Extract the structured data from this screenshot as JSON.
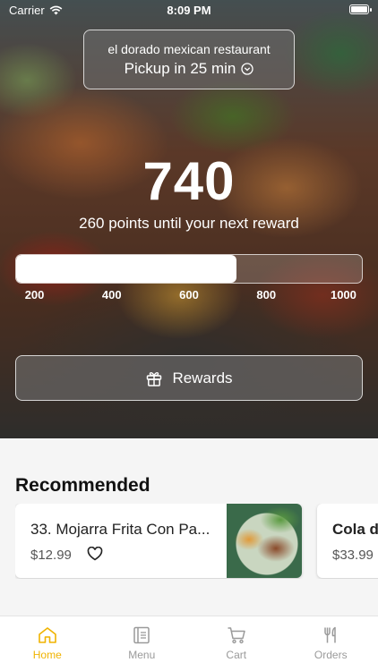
{
  "status_bar": {
    "carrier": "Carrier",
    "time": "8:09 PM"
  },
  "store": {
    "name": "el dorado mexican restaurant",
    "pickup": "Pickup in 25 min"
  },
  "loyalty": {
    "points": "740",
    "message": "260 points until your next reward",
    "progress_fraction": 0.637,
    "scale_min": 150,
    "scale_max": 1050,
    "ticks": [
      "200",
      "400",
      "600",
      "800",
      "1000"
    ],
    "rewards_label": "Rewards"
  },
  "recommended": {
    "title": "Recommended",
    "items": [
      {
        "name": "33. Mojarra Frita Con Pa...",
        "price": "$12.99"
      },
      {
        "name": "Cola de",
        "price": "$33.99"
      }
    ]
  },
  "tabs": [
    {
      "label": "Home",
      "icon": "home-icon",
      "active": true
    },
    {
      "label": "Menu",
      "icon": "menu-icon",
      "active": false
    },
    {
      "label": "Cart",
      "icon": "cart-icon",
      "active": false
    },
    {
      "label": "Orders",
      "icon": "orders-icon",
      "active": false
    }
  ],
  "colors": {
    "accent": "#f0b300",
    "inactive": "#9a9a9a"
  }
}
